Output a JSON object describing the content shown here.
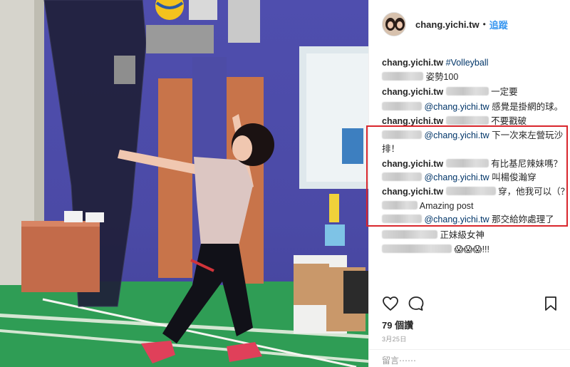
{
  "post": {
    "username": "chang.yichi.tw",
    "dot": "•",
    "follow_label": "追蹤",
    "likes_text": "79 個讚",
    "date_text": "3月25日",
    "add_comment_placeholder": "留言⋯⋯"
  },
  "comments": [
    {
      "user": "chang.yichi.tw",
      "user_blurred": false,
      "mention": "",
      "text": "#Volleyball",
      "text_is_link": true
    },
    {
      "user": "",
      "user_blurred": true,
      "mention": "",
      "text": "姿勢100"
    },
    {
      "user": "chang.yichi.tw",
      "user_blurred": false,
      "mention": "",
      "text": "一定要",
      "pre_blur": true
    },
    {
      "user": "",
      "user_blurred": true,
      "mention": "@chang.yichi.tw",
      "text": "感覺是掛網的球。"
    },
    {
      "user": "chang.yichi.tw",
      "user_blurred": false,
      "mention": "",
      "text": "不要戳破",
      "pre_blur": true
    },
    {
      "user": "",
      "user_blurred": true,
      "mention": "@chang.yichi.tw",
      "text": "下一次來左營玩沙"
    },
    {
      "user": "",
      "user_blurred": false,
      "mention": "",
      "text": "排！"
    },
    {
      "user": "chang.yichi.tw",
      "user_blurred": false,
      "mention": "",
      "text": "有比基尼辣妹嗎？",
      "pre_blur": true
    },
    {
      "user": "",
      "user_blurred": true,
      "mention": "@chang.yichi.tw",
      "text": "叫楊俊瀚穿"
    },
    {
      "user": "chang.yichi.tw",
      "user_blurred": false,
      "mention": "",
      "text": "穿，他我可以（？",
      "pre_blur": true
    },
    {
      "user": "",
      "user_blurred": true,
      "mention": "",
      "text": "Amazing post"
    },
    {
      "user": "",
      "user_blurred": true,
      "mention": "@chang.yichi.tw",
      "text": "那交給妳處理了"
    },
    {
      "user": "",
      "user_blurred": true,
      "mention": "",
      "text": "正妹級女神"
    },
    {
      "user": "",
      "user_blurred": true,
      "mention": "",
      "text": "😱😱😱!!!"
    }
  ],
  "colors": {
    "accent": "#3897f0",
    "highlight_border": "#d9262c",
    "court_floor": "#2f9d55",
    "wall": "#4f4eae"
  },
  "icons": {
    "like": "heart-outline-icon",
    "comment": "speech-bubble-icon",
    "save": "bookmark-icon"
  }
}
